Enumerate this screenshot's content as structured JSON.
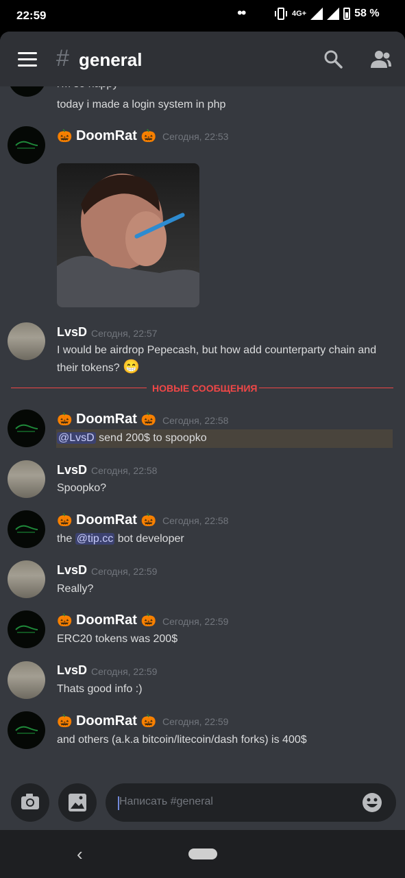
{
  "status": {
    "time": "22:59",
    "network": "4G+",
    "battery": "58 %"
  },
  "header": {
    "hash": "#",
    "channel": "general"
  },
  "messages": {
    "cut_text": "i'm so happy",
    "prev_text": "today i made a login system in php",
    "m1": {
      "author": "DoomRat",
      "time": "Сегодня, 22:53"
    },
    "m2": {
      "author": "LvsD",
      "time": "Сегодня, 22:57",
      "text": "I would be airdrop Pepecash, but how add counterparty chain and their tokens?"
    },
    "divider": "НОВЫЕ СООБЩЕНИЯ",
    "m3": {
      "author": "DoomRat",
      "time": "Сегодня, 22:58",
      "mention": "@LvsD",
      "text": " send 200$ to spoopko"
    },
    "m4": {
      "author": "LvsD",
      "time": "Сегодня, 22:58",
      "text": "Spoopko?"
    },
    "m5": {
      "author": "DoomRat",
      "time": "Сегодня, 22:58",
      "pre": "the ",
      "mention": "@tip.cc",
      "post": " bot developer"
    },
    "m6": {
      "author": "LvsD",
      "time": "Сегодня, 22:59",
      "text": "Really?"
    },
    "m7": {
      "author": "DoomRat",
      "time": "Сегодня, 22:59",
      "text": "ERC20 tokens was 200$"
    },
    "m8": {
      "author": "LvsD",
      "time": "Сегодня, 22:59",
      "text": "Thats good info :)"
    },
    "m9": {
      "author": "DoomRat",
      "time": "Сегодня, 22:59",
      "text": "and others (a.k.a bitcoin/litecoin/dash forks) is 400$"
    }
  },
  "composer": {
    "placeholder": "Написать #general"
  },
  "icons": {
    "menu": "hamburger-icon",
    "search": "search-icon",
    "members": "members-icon",
    "camera": "camera-icon",
    "image": "image-icon",
    "emoji": "emoji-icon",
    "pumpkin": "🎃",
    "grin": "😁"
  },
  "colors": {
    "background": "#36393f",
    "header": "#2f3136",
    "new_messages": "#f04747",
    "mention": "#7289da"
  }
}
